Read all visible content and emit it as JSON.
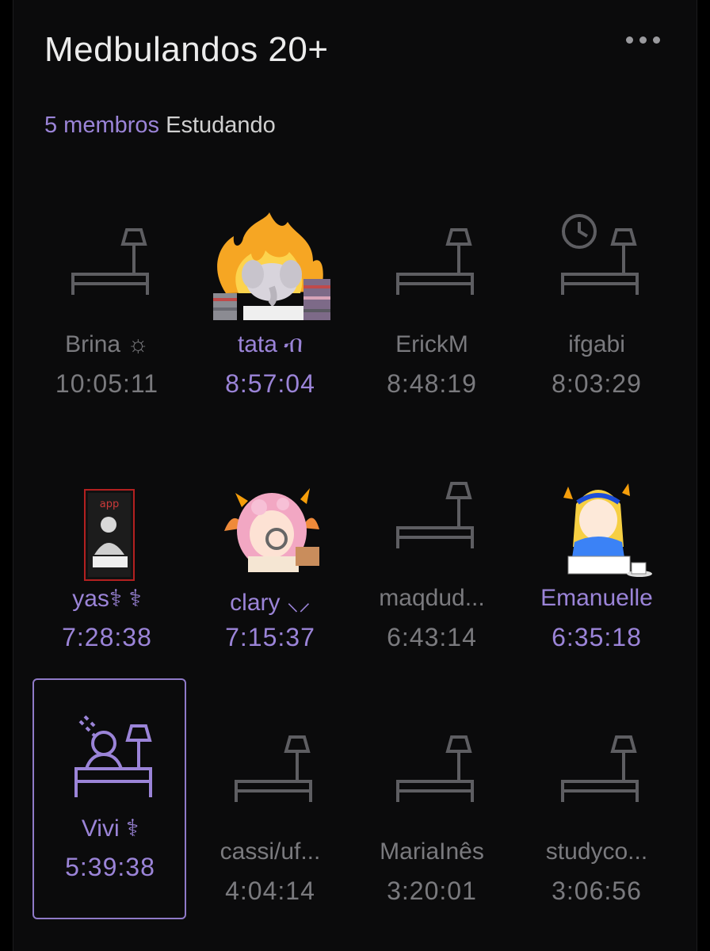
{
  "header": {
    "title": "Medbulandos 20+",
    "members": "5 membros",
    "status": "Estudando",
    "more_icon": "more-dots-icon"
  },
  "colors": {
    "accent": "#9b84d8",
    "inactive": "#7a7a7e",
    "desk_inactive": "#5e5e62",
    "background": "#0b0b0c"
  },
  "members": [
    {
      "name": "Brina ☼",
      "time": "10:05:11",
      "online": false,
      "avatar": "empty-desk-icon"
    },
    {
      "name": "tata ብ",
      "time": "8:57:04",
      "online": true,
      "avatar": "elephant-fire-avatar"
    },
    {
      "name": "ErickM",
      "time": "8:48:19",
      "online": false,
      "avatar": "empty-desk-icon"
    },
    {
      "name": "ifgabi",
      "time": "8:03:29",
      "online": false,
      "avatar": "desk-clock-icon"
    },
    {
      "name": "yas⚕ ⚕",
      "time": "7:28:38",
      "online": true,
      "avatar": "dark-study-avatar"
    },
    {
      "name": "clary ⸜⸝",
      "time": "7:15:37",
      "online": true,
      "avatar": "pink-girl-avatar"
    },
    {
      "name": "maqdud...",
      "time": "6:43:14",
      "online": false,
      "avatar": "empty-desk-icon"
    },
    {
      "name": "Emanuelle",
      "time": "6:35:18",
      "online": true,
      "avatar": "alice-reading-avatar"
    },
    {
      "name": "Vivi ⚕",
      "time": "5:39:38",
      "online": true,
      "avatar": "studying-person-icon"
    },
    {
      "name": "cassi/uf...",
      "time": "4:04:14",
      "online": false,
      "avatar": "empty-desk-icon"
    },
    {
      "name": "MariaInês",
      "time": "3:20:01",
      "online": false,
      "avatar": "empty-desk-icon"
    },
    {
      "name": "studyco...",
      "time": "3:06:56",
      "online": false,
      "avatar": "empty-desk-icon"
    }
  ]
}
